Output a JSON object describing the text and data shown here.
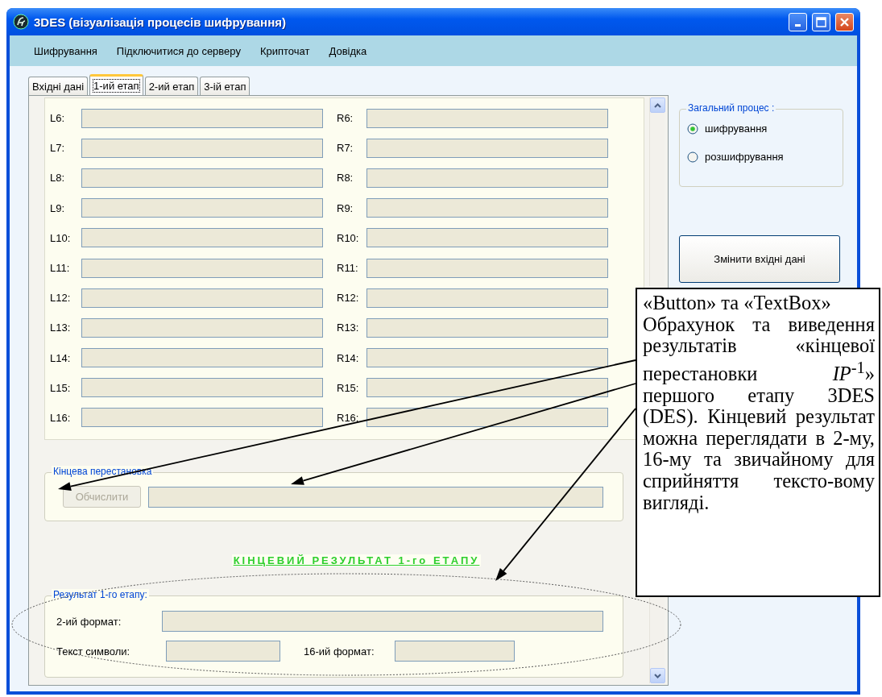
{
  "window": {
    "title": "3DES (візуалізація процесів шифрування)"
  },
  "menu": [
    "Шифрування",
    "Підключитися до серверу",
    "Крипточат",
    "Довідка"
  ],
  "tabs": [
    {
      "label": "Вхідні дані",
      "selected": false
    },
    {
      "label": "1-ий етап",
      "selected": true
    },
    {
      "label": "2-ий етап",
      "selected": false
    },
    {
      "label": "3-ій етап",
      "selected": false
    }
  ],
  "rounds": [
    {
      "left": "L6:",
      "right": "R6:"
    },
    {
      "left": "L7:",
      "right": "R7:"
    },
    {
      "left": "L8:",
      "right": "R8:"
    },
    {
      "left": "L9:",
      "right": "R9:"
    },
    {
      "left": "L10:",
      "right": "R10:"
    },
    {
      "left": "L11:",
      "right": "R11:"
    },
    {
      "left": "L12:",
      "right": "R12:"
    },
    {
      "left": "L13:",
      "right": "R13:"
    },
    {
      "left": "L14:",
      "right": "R14:"
    },
    {
      "left": "L15:",
      "right": "R15:"
    },
    {
      "left": "L16:",
      "right": "R16:"
    }
  ],
  "final_permutation": {
    "title": "Кінцева перестановка",
    "button": {
      "label": "Обчислити",
      "disabled": true
    }
  },
  "result_heading": "КІНЦЕВИЙ РЕЗУЛЬТАТ 1-го ЕТАПУ",
  "result_group": {
    "title": "Результат 1-го етапу:",
    "binary_label": "2-ий формат:",
    "text_label": "Текст символи:",
    "hex_label": "16-ий формат:"
  },
  "process_group": {
    "title": "Загальний процес :",
    "options": [
      {
        "label": "шифрування",
        "selected": true
      },
      {
        "label": "розшифрування",
        "selected": false
      }
    ]
  },
  "change_button": "Змінити вхідні дані",
  "callout": {
    "title": "«Button» та «TextBox»",
    "text": "Обрахунок та виведення результатів «кінцевої перестановки *IP*$^{-1}$» першого етапу 3DES (DES). Кінцевий результат можна переглядати в 2-му, 16-му та звичайному для сприйняття тексто-вому вигляді."
  }
}
